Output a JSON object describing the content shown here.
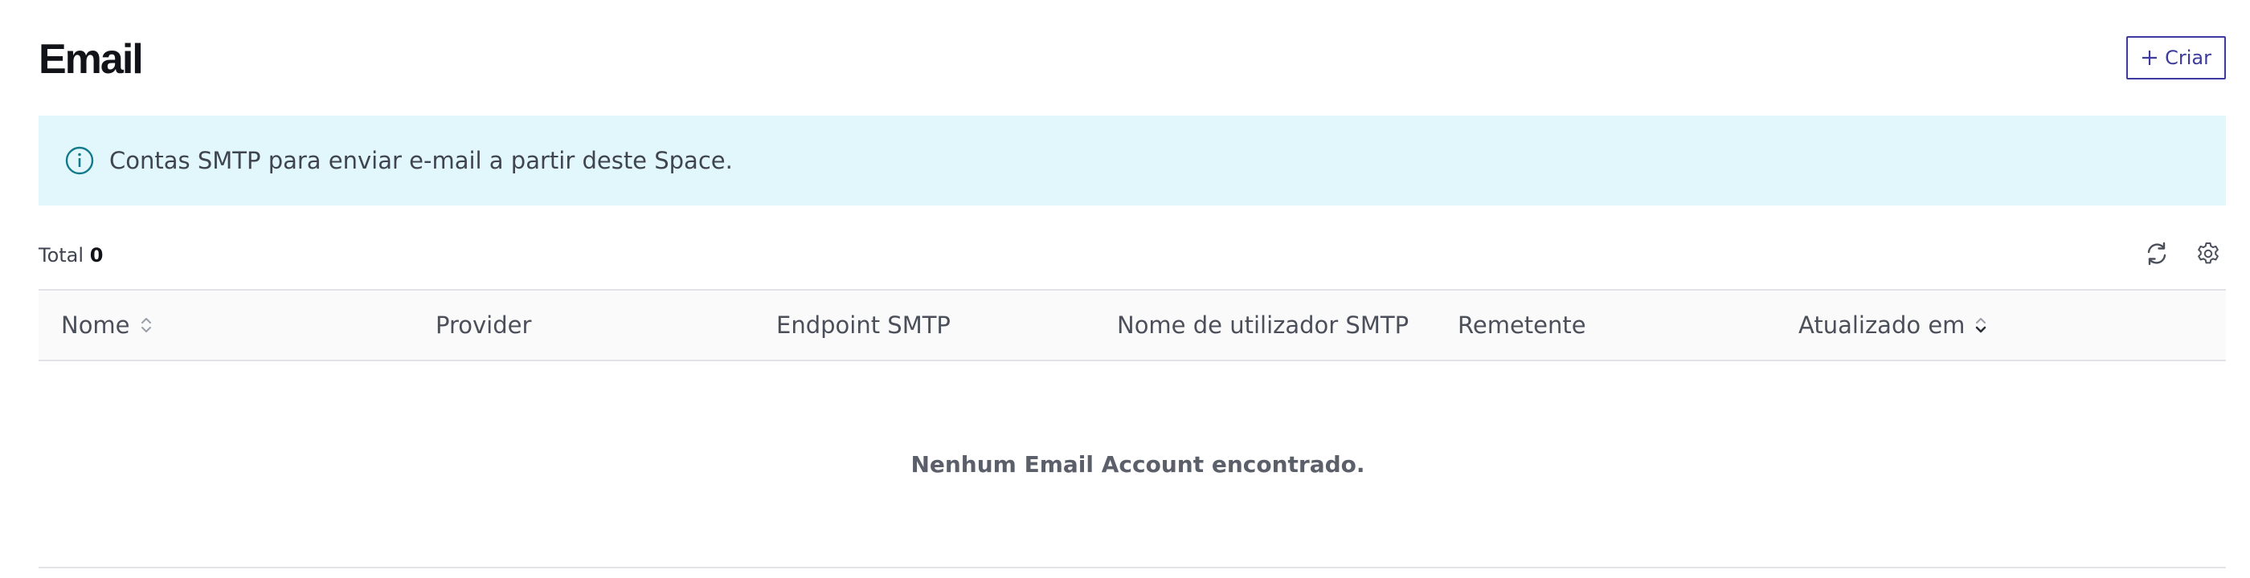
{
  "header": {
    "title": "Email",
    "create_label": "Criar"
  },
  "banner": {
    "text": "Contas SMTP para enviar e-mail a partir deste Space.",
    "icon": "info-icon"
  },
  "toolbar": {
    "total_label": "Total",
    "total_count": "0",
    "icons": [
      "refresh-icon",
      "gear-icon"
    ]
  },
  "table": {
    "columns": [
      {
        "label": "Nome",
        "sort": "sortable"
      },
      {
        "label": "Provider",
        "sort": "none"
      },
      {
        "label": "Endpoint SMTP",
        "sort": "none"
      },
      {
        "label": "Nome de utilizador SMTP",
        "sort": "none"
      },
      {
        "label": "Remetente",
        "sort": "none"
      },
      {
        "label": "Atualizado em",
        "sort": "descending"
      }
    ],
    "empty_message": "Nenhum Email Account encontrado."
  },
  "colors": {
    "accent": "#3d3b9e",
    "info_bg": "#e1f7fc",
    "info_icon": "#127a8a"
  }
}
